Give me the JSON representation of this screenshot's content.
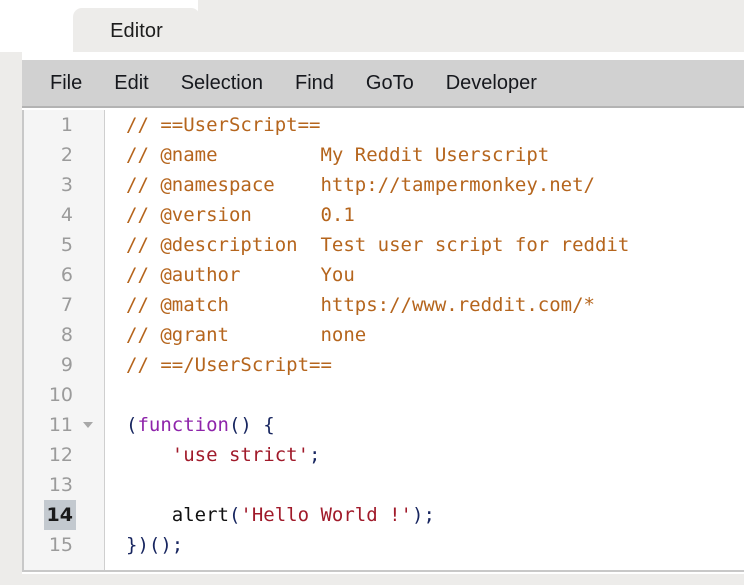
{
  "window": {
    "tab_label": "Editor"
  },
  "menubar": {
    "items": [
      {
        "label": "File"
      },
      {
        "label": "Edit"
      },
      {
        "label": "Selection"
      },
      {
        "label": "Find"
      },
      {
        "label": "GoTo"
      },
      {
        "label": "Developer"
      }
    ]
  },
  "editor": {
    "active_line": 14,
    "fold_line": 11,
    "colors": {
      "comment": "#b5651d",
      "keyword": "#8e24aa",
      "string": "#a01a2a",
      "punctuation": "#17255f",
      "plain": "#111111",
      "gutter_background": "#f5f5f5",
      "active_line_number_background": "#c3c9cf",
      "menubar_background": "#d1d1d1",
      "tab_background": "#edecea"
    },
    "lines": [
      {
        "n": "1",
        "text": "// ==UserScript=="
      },
      {
        "n": "2",
        "text": "// @name         My Reddit Userscript"
      },
      {
        "n": "3",
        "text": "// @namespace    http://tampermonkey.net/"
      },
      {
        "n": "4",
        "text": "// @version      0.1"
      },
      {
        "n": "5",
        "text": "// @description  Test user script for reddit"
      },
      {
        "n": "6",
        "text": "// @author       You"
      },
      {
        "n": "7",
        "text": "// @match        https://www.reddit.com/*"
      },
      {
        "n": "8",
        "text": "// @grant        none"
      },
      {
        "n": "9",
        "text": "// ==/UserScript=="
      },
      {
        "n": "10",
        "text": ""
      },
      {
        "n": "11",
        "text": "(function() {"
      },
      {
        "n": "12",
        "text": "    'use strict';"
      },
      {
        "n": "13",
        "text": ""
      },
      {
        "n": "14",
        "text": "    alert('Hello World !');"
      },
      {
        "n": "15",
        "text": "})();"
      }
    ],
    "tokens": [
      [
        {
          "t": "// ==UserScript==",
          "c": "comment"
        }
      ],
      [
        {
          "t": "// @name         My Reddit Userscript",
          "c": "comment"
        }
      ],
      [
        {
          "t": "// @namespace    http://tampermonkey.net/",
          "c": "comment"
        }
      ],
      [
        {
          "t": "// @version      0.1",
          "c": "comment"
        }
      ],
      [
        {
          "t": "// @description  Test user script for reddit",
          "c": "comment"
        }
      ],
      [
        {
          "t": "// @author       You",
          "c": "comment"
        }
      ],
      [
        {
          "t": "// @match        https://www.reddit.com/*",
          "c": "comment"
        }
      ],
      [
        {
          "t": "// @grant        none",
          "c": "comment"
        }
      ],
      [
        {
          "t": "// ==/UserScript==",
          "c": "comment"
        }
      ],
      [],
      [
        {
          "t": "(",
          "c": "punct"
        },
        {
          "t": "function",
          "c": "keyword"
        },
        {
          "t": "() {",
          "c": "punct"
        }
      ],
      [
        {
          "t": "    ",
          "c": "plain"
        },
        {
          "t": "'use strict'",
          "c": "string"
        },
        {
          "t": ";",
          "c": "punct"
        }
      ],
      [],
      [
        {
          "t": "    alert",
          "c": "plain"
        },
        {
          "t": "(",
          "c": "punct"
        },
        {
          "t": "'Hello World !'",
          "c": "string"
        },
        {
          "t": ");",
          "c": "punct"
        }
      ],
      [
        {
          "t": "})();",
          "c": "punct"
        }
      ]
    ]
  }
}
